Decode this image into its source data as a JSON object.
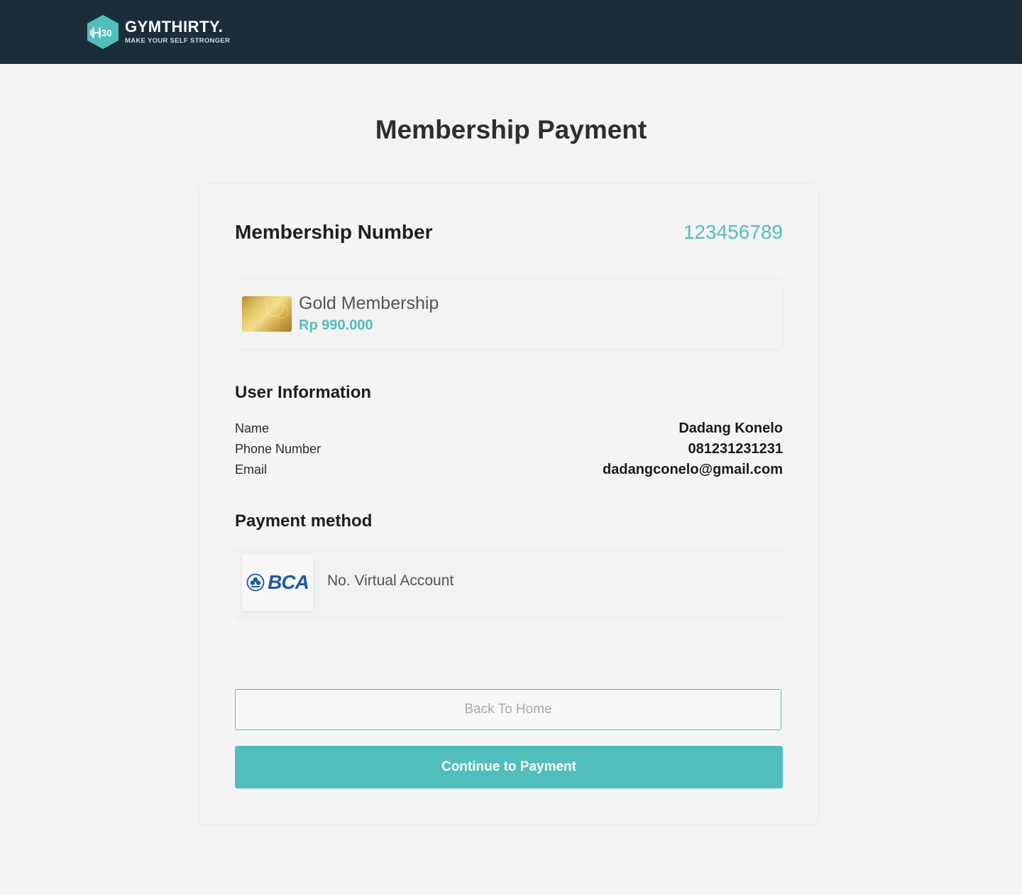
{
  "header": {
    "brand_name": "GYMTHIRTY.",
    "brand_tagline": "MAKE YOUR SELF STRONGER",
    "logo_badge_text": "30"
  },
  "page": {
    "title": "Membership Payment"
  },
  "membership": {
    "label": "Membership Number",
    "number": "123456789"
  },
  "plan": {
    "name": "Gold Membership",
    "price": "Rp 990.000"
  },
  "user_info": {
    "title": "User Information",
    "rows": [
      {
        "label": "Name",
        "value": "Dadang Konelo"
      },
      {
        "label": "Phone Number",
        "value": "081231231231"
      },
      {
        "label": "Email",
        "value": "dadangconelo@gmail.com"
      }
    ]
  },
  "payment": {
    "title": "Payment method",
    "bank": "BCA",
    "method_label": "No. Virtual Account"
  },
  "actions": {
    "back_label": "Back To Home",
    "continue_label": "Continue to Payment"
  },
  "colors": {
    "header_bg": "#1b2d3a",
    "accent": "#4fbfbb",
    "page_bg": "#f4f4f4",
    "bank_blue": "#1a5aa8"
  }
}
